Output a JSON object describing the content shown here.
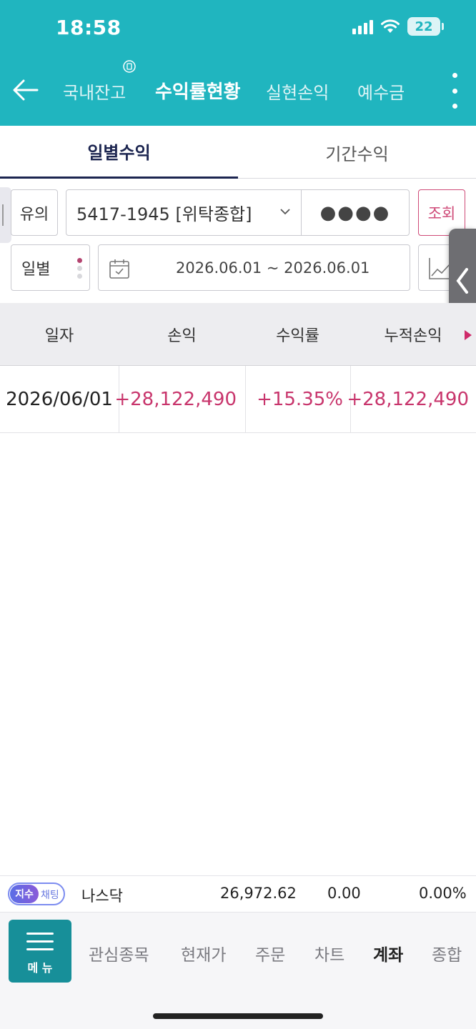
{
  "status_bar": {
    "time": "18:58",
    "battery": "22"
  },
  "nav": {
    "tabs": [
      "국내잔고",
      "수익률현황",
      "실현손익",
      "예수금"
    ]
  },
  "subtabs": [
    "일별수익",
    "기간수익"
  ],
  "filters": {
    "yuui_label": "유의",
    "account": "5417-1945 [위탁종합]",
    "password_mask": "●●●●",
    "query_label": "조회",
    "period_label": "일별",
    "date_range": "2026.06.01 ~ 2026.06.01"
  },
  "table": {
    "headers": [
      "일자",
      "손익",
      "수익률",
      "누적손익"
    ],
    "rows": [
      {
        "date": "2026/06/01",
        "pnl": "+28,122,490",
        "rate": "+15.35%",
        "cum": "+28,122,490"
      }
    ]
  },
  "ticker": {
    "toggle_on": "지수",
    "toggle_off": "채팅",
    "name": "나스닥",
    "value": "26,972.62",
    "change": "0.00",
    "change_rate": "0.00%"
  },
  "bottom_nav": {
    "menu_label": "메 뉴",
    "items": [
      "관심종목",
      "현재가",
      "주문",
      "차트",
      "계좌",
      "종합"
    ]
  },
  "colors": {
    "header": "#20b5bf",
    "positive": "#c8356c",
    "menu_button": "#178f99"
  }
}
